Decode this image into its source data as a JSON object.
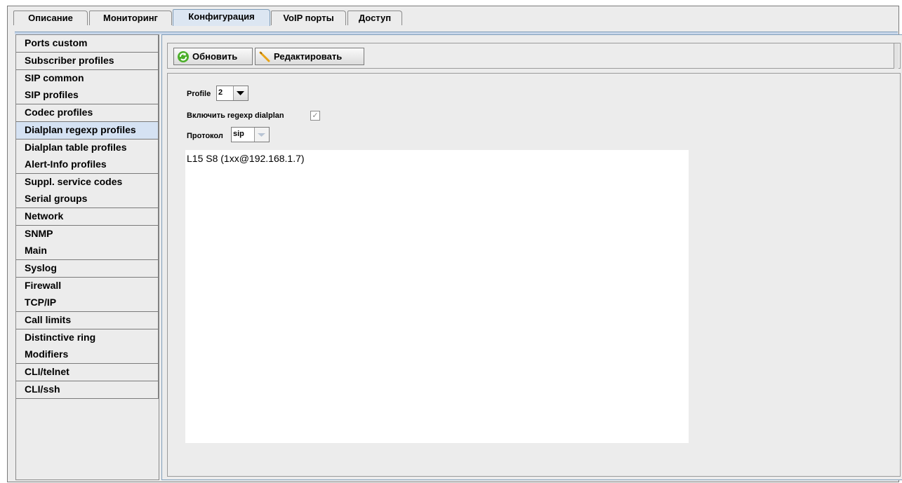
{
  "tabs": [
    {
      "label": "Описание",
      "active": false
    },
    {
      "label": "Мониторинг",
      "active": false
    },
    {
      "label": "Конфигурация",
      "active": true
    },
    {
      "label": "VoIP порты",
      "active": false
    },
    {
      "label": "Доступ",
      "active": false
    }
  ],
  "sidebar": {
    "items": [
      {
        "label": "Ports custom"
      },
      {
        "label": "Subscriber profiles"
      },
      {
        "label": "SIP common"
      },
      {
        "label": "SIP profiles"
      },
      {
        "label": "Codec profiles"
      },
      {
        "label": "Dialplan regexp profiles",
        "active": true
      },
      {
        "label": "Dialplan table profiles"
      },
      {
        "label": "Alert-Info profiles"
      },
      {
        "label": "Suppl. service codes"
      },
      {
        "label": "Serial groups"
      },
      {
        "label": "Network"
      },
      {
        "label": "SNMP"
      },
      {
        "label": "Main"
      },
      {
        "label": "Syslog"
      },
      {
        "label": "Firewall"
      },
      {
        "label": "TCP/IP"
      },
      {
        "label": "Call limits"
      },
      {
        "label": "Distinctive ring"
      },
      {
        "label": "Modifiers"
      },
      {
        "label": "CLI/telnet"
      },
      {
        "label": "CLI/ssh"
      }
    ]
  },
  "toolbar": {
    "refresh_label": "Обновить",
    "refresh_icon": "refresh-icon",
    "edit_label": "Редактировать",
    "edit_icon": "pencil-icon"
  },
  "form": {
    "profile_label": "Profile",
    "profile_value": "2",
    "regexp_label": "Включить regexp dialplan",
    "regexp_checked": true,
    "protocol_label": "Протокол",
    "protocol_value": "sip"
  },
  "dialplan": {
    "text": "L15 S8 (1xx@192.168.1.7)"
  },
  "colors": {
    "active_tab": "#dce6f2",
    "active_sidebar": "#d5e2f3",
    "panel_bg": "#ececec"
  }
}
